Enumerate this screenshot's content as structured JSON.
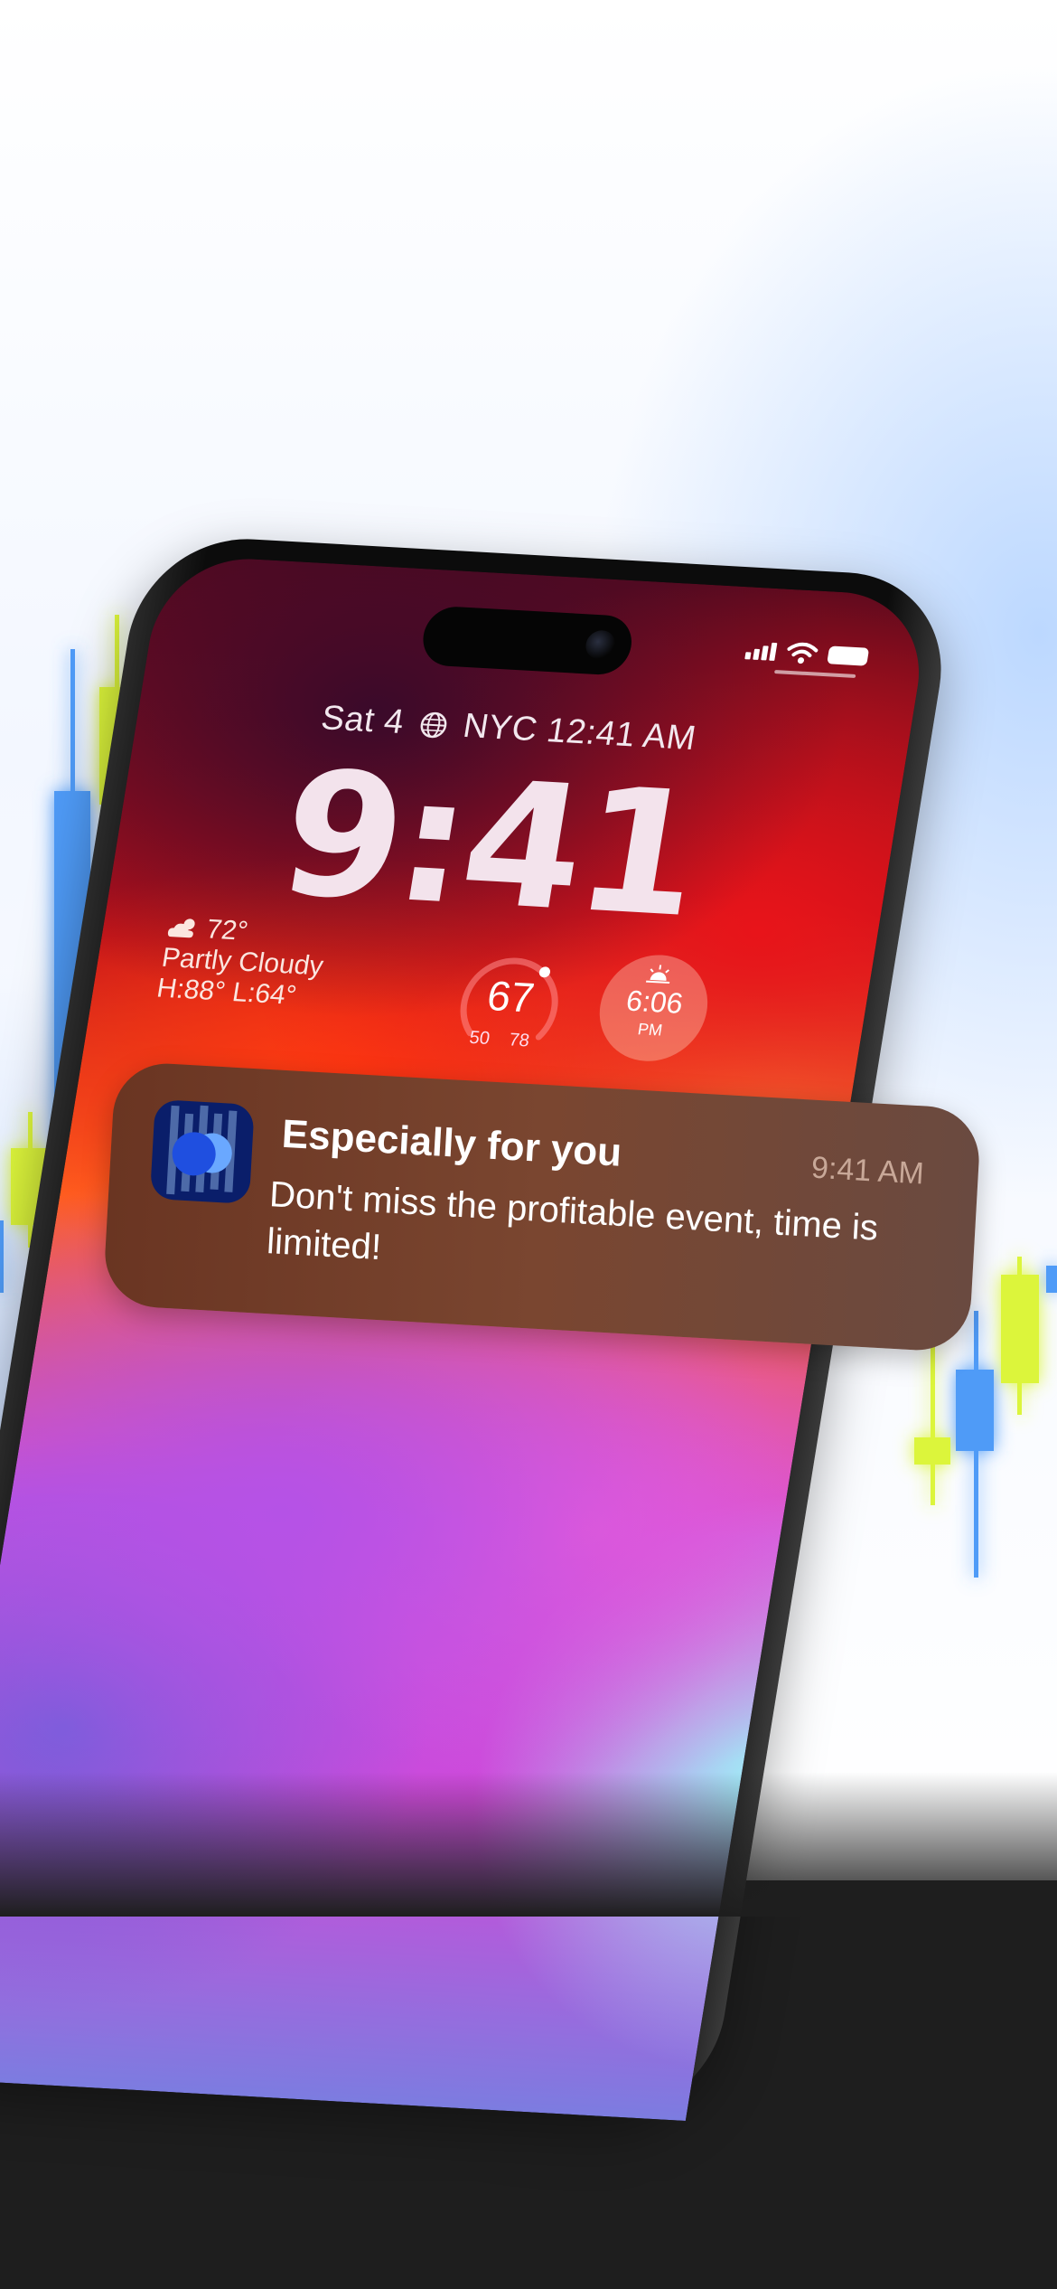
{
  "lock_screen": {
    "date": "Sat 4",
    "city_time": "NYC 12:41 AM",
    "clock": "9:41"
  },
  "status_bar": {
    "icons": [
      "cellular-signal-icon",
      "wifi-icon",
      "battery-icon"
    ]
  },
  "weather_widget": {
    "temperature": "72°",
    "condition": "Partly Cloudy",
    "high_low": "H:88° L:64°"
  },
  "temperature_gauge": {
    "value": "67",
    "low": "50",
    "high": "78"
  },
  "sunset_widget": {
    "time": "6:06",
    "period": "PM"
  },
  "notification": {
    "title": "Especially for you",
    "time": "9:41 AM",
    "body": "Don't miss the profitable event, time is limited!"
  },
  "colors": {
    "candle_blue": "#4f9bf7",
    "candle_yellow": "#dcf53a",
    "notification_bg": "#74402c"
  }
}
